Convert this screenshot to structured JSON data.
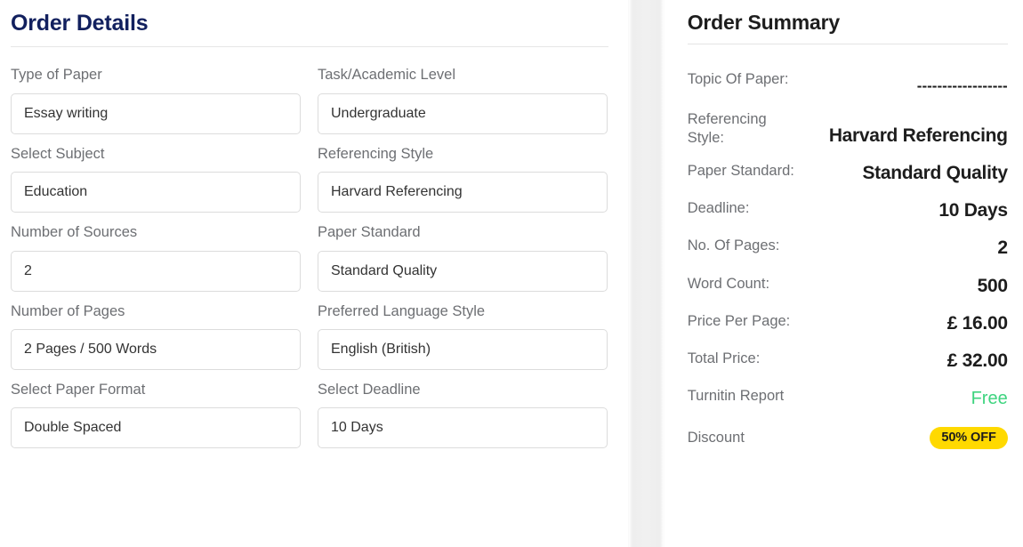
{
  "order_details": {
    "title": "Order Details",
    "fields": [
      {
        "label": "Type of Paper",
        "value": "Essay writing",
        "name": "type-of-paper"
      },
      {
        "label": "Task/Academic Level",
        "value": "Undergraduate",
        "name": "task-academic-level"
      },
      {
        "label": "Select Subject",
        "value": "Education",
        "name": "select-subject"
      },
      {
        "label": "Referencing Style",
        "value": "Harvard Referencing",
        "name": "referencing-style"
      },
      {
        "label": "Number of Sources",
        "value": "2",
        "name": "number-of-sources"
      },
      {
        "label": "Paper Standard",
        "value": "Standard Quality",
        "name": "paper-standard"
      },
      {
        "label": "Number of Pages",
        "value": "2 Pages / 500 Words",
        "name": "number-of-pages"
      },
      {
        "label": "Preferred Language Style",
        "value": "English (British)",
        "name": "preferred-language-style"
      },
      {
        "label": "Select Paper Format",
        "value": "Double Spaced",
        "name": "select-paper-format"
      },
      {
        "label": "Select Deadline",
        "value": "10 Days",
        "name": "select-deadline"
      }
    ]
  },
  "order_summary": {
    "title": "Order Summary",
    "rows": [
      {
        "label": "Topic Of Paper:",
        "value": "------------------",
        "style": "dashes",
        "name": "topic-of-paper"
      },
      {
        "label": "Referencing Style:",
        "value": "Harvard Referencing",
        "style": "normal",
        "name": "referencing-style"
      },
      {
        "label": "Paper Standard:",
        "value": "Standard Quality",
        "style": "normal",
        "name": "paper-standard"
      },
      {
        "label": "Deadline:",
        "value": "10 Days",
        "style": "normal",
        "name": "deadline"
      },
      {
        "label": "No. Of Pages:",
        "value": "2",
        "style": "normal",
        "name": "no-of-pages"
      },
      {
        "label": "Word Count:",
        "value": "500",
        "style": "normal",
        "name": "word-count"
      },
      {
        "label": "Price Per Page:",
        "value": "£ 16.00",
        "style": "normal",
        "name": "price-per-page"
      },
      {
        "label": "Total Price:",
        "value": "£ 32.00",
        "style": "normal",
        "name": "total-price"
      },
      {
        "label": "Turnitin Report",
        "value": "Free",
        "style": "free",
        "name": "turnitin-report"
      }
    ],
    "discount": {
      "label": "Discount",
      "badge": "50% OFF"
    }
  },
  "colors": {
    "details_title": "#12205e",
    "summary_title": "#1d1d1d",
    "label_gray": "#6d6f73",
    "value_dark": "#1d1d1d",
    "free_green": "#3ed47f",
    "badge_yellow": "#ffd900",
    "input_border": "#dcdcdc",
    "divider": "#e6e6e6"
  }
}
